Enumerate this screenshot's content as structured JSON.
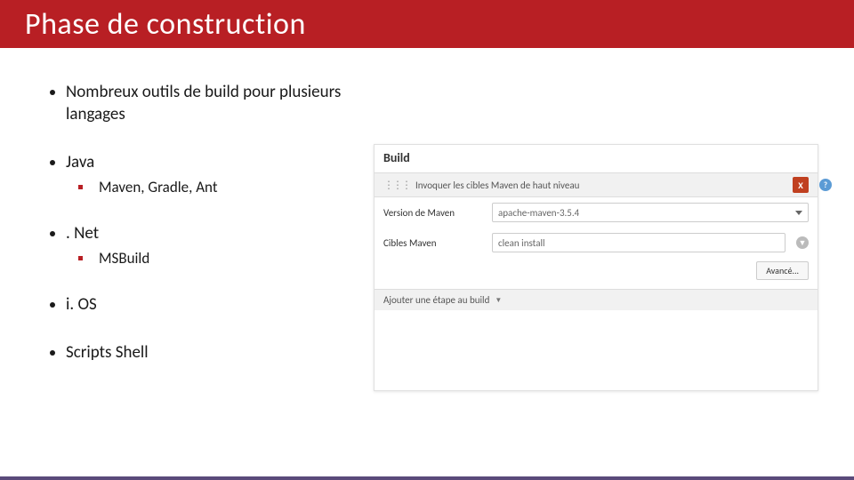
{
  "header": {
    "title": "Phase de construction"
  },
  "bullets": {
    "intro": "Nombreux outils de build pour plusieurs langages",
    "java": {
      "label": "Java",
      "sub": "Maven, Gradle, Ant"
    },
    "dotnet": {
      "label": ". Net",
      "sub": "MSBuild"
    },
    "ios": {
      "label": "i. OS"
    },
    "shell": {
      "label": "Scripts Shell"
    }
  },
  "screenshot": {
    "title": "Build",
    "section_label": "Invoquer les cibles Maven de haut niveau",
    "delete": "X",
    "help": "?",
    "fields": {
      "version": {
        "label": "Version de Maven",
        "value": "apache-maven-3.5.4"
      },
      "goals": {
        "label": "Cibles Maven",
        "value": "clean install"
      }
    },
    "advanced": "Avancé...",
    "add_step": "Ajouter une étape au build",
    "chev": "▼"
  }
}
